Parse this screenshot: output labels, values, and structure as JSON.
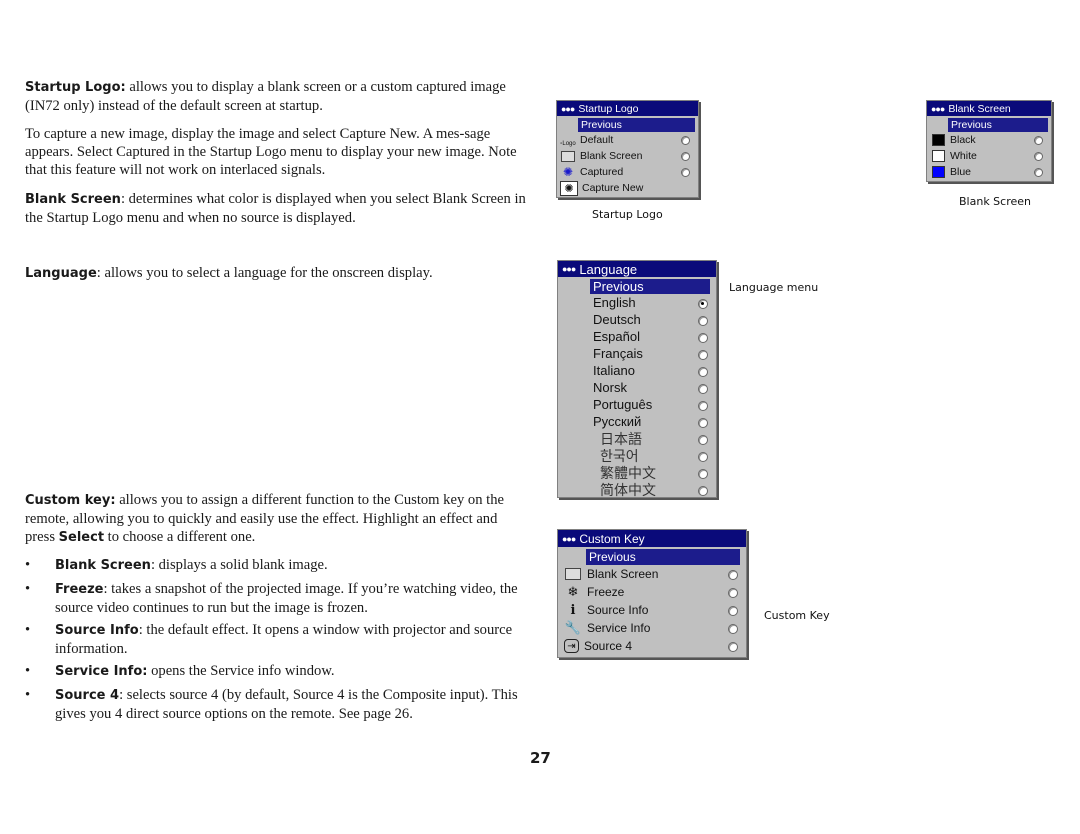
{
  "text": {
    "startup_logo": {
      "label": "Startup Logo:",
      "body": " allows you to display a blank screen or a custom captured image (IN72 only) instead of the default screen at startup."
    },
    "capture_new": "To capture a new image, display the image and select Capture New. A mes-sage appears. Select Captured in the Startup Logo menu to display your new image. Note that this feature will not work on interlaced signals.",
    "blank_screen": {
      "label": "Blank Screen",
      "body": ": determines what color is displayed when you select Blank Screen in the Startup Logo menu and when no source is displayed."
    },
    "language": {
      "label": "Language",
      "body": ": allows you to select a language for the onscreen display."
    },
    "custom_key": {
      "label": "Custom key:",
      "body1": " allows you to assign a different function to the Custom key on the remote, allowing you to quickly and easily use the effect. Highlight an effect and press ",
      "select": "Select",
      "body2": " to choose a different one."
    },
    "bullets": [
      {
        "label": "Blank Screen",
        "body": ": displays a solid blank image."
      },
      {
        "label": "Freeze",
        "body": ": takes a snapshot of the projected image. If you’re watching video, the source video continues to run but the image is frozen."
      },
      {
        "label": "Source Info",
        "body": ": the default effect. It opens a window with projector and source information."
      },
      {
        "label": "Service Info:",
        "body": " opens the Service info window."
      },
      {
        "label": "Source 4",
        "body": ": selects source 4 (by default, Source 4 is the Composite input). This gives you 4 direct source options on the remote. See page 26."
      }
    ],
    "bullet_char": "•",
    "page_number": "27"
  },
  "menus": {
    "startup_logo": {
      "title": "Startup Logo",
      "previous": "Previous",
      "caption": "Startup Logo",
      "items": [
        {
          "label": "Default",
          "icon": "logo-icon",
          "radio": true,
          "selected": false
        },
        {
          "label": "Blank Screen",
          "icon": "blank-screen-icon",
          "radio": true,
          "selected": false
        },
        {
          "label": "Captured",
          "icon": "captured-icon",
          "radio": true,
          "selected": false
        },
        {
          "label": "Capture New",
          "icon": "capture-new-icon",
          "radio": false,
          "selected": false
        }
      ]
    },
    "blank_screen": {
      "title": "Blank Screen",
      "previous": "Previous",
      "caption": "Blank Screen",
      "items": [
        {
          "label": "Black",
          "color": "#000000"
        },
        {
          "label": "White",
          "color": "#ffffff"
        },
        {
          "label": "Blue",
          "color": "#0000ff"
        }
      ]
    },
    "language": {
      "title": "Language",
      "previous": "Previous",
      "caption": "Language menu",
      "items": [
        "English",
        "Deutsch",
        "Español",
        "Français",
        "Italiano",
        "Norsk",
        "Português",
        "Русский",
        "日本語",
        "한국어",
        "繁體中文",
        "简体中文"
      ],
      "selected": "English"
    },
    "custom_key": {
      "title": "Custom Key",
      "previous": "Previous",
      "caption": "Custom Key",
      "items": [
        {
          "label": "Blank Screen",
          "icon": "blank-screen-icon"
        },
        {
          "label": "Freeze",
          "icon": "freeze-icon"
        },
        {
          "label": "Source Info",
          "icon": "info-icon"
        },
        {
          "label": "Service Info",
          "icon": "service-wrench-icon"
        },
        {
          "label": "Source 4",
          "icon": "source-input-icon"
        }
      ]
    }
  },
  "colors": {
    "menu_title_bg": "#0a0a7a",
    "menu_bg": "#c0c0c0"
  }
}
